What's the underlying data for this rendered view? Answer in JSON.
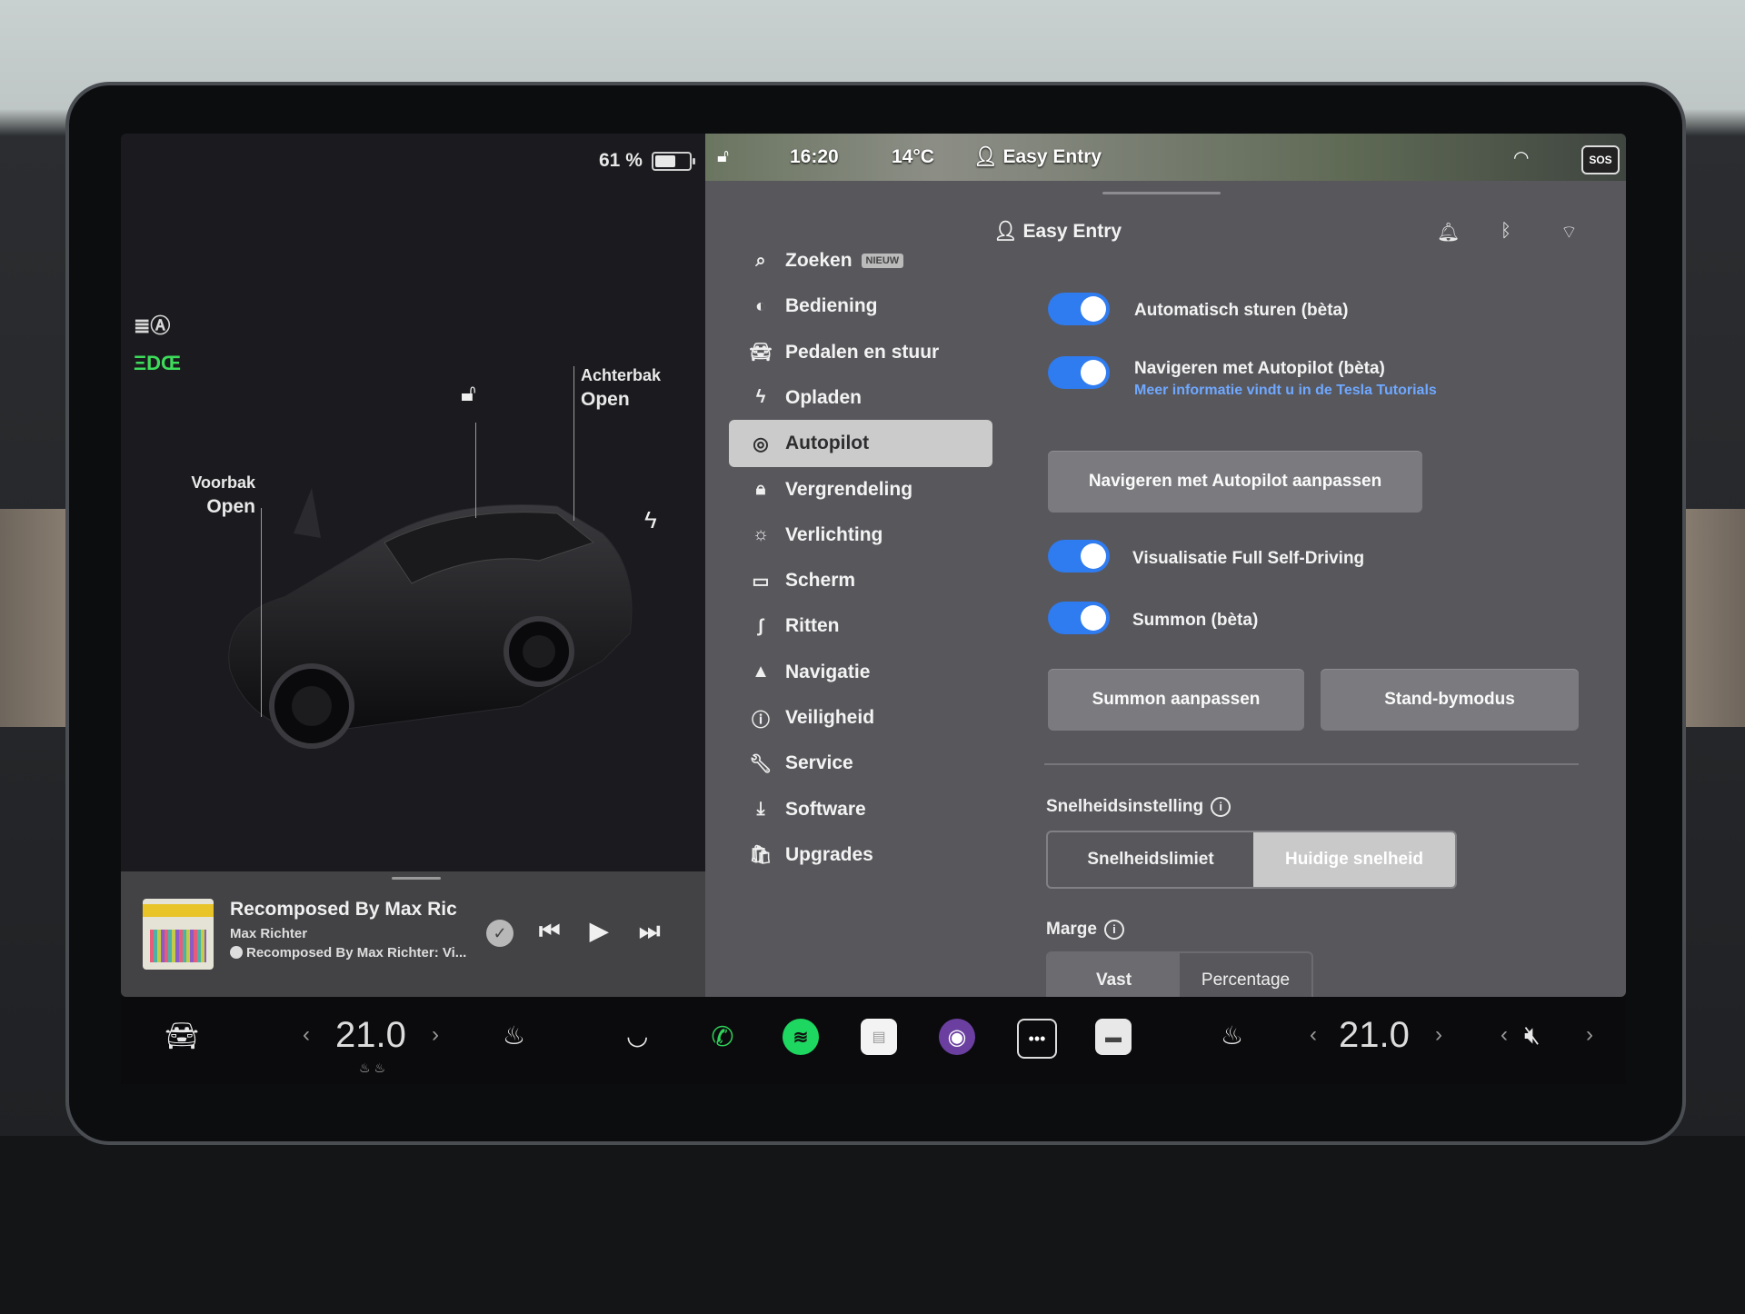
{
  "status": {
    "battery_pct": "61 %",
    "battery_level": 0.61,
    "time": "16:20",
    "outside_temp": "14°C",
    "profile": "Easy Entry",
    "sos": "SOS"
  },
  "car": {
    "frunk_label": "Voorbak",
    "frunk_state": "Open",
    "trunk_label": "Achterbak",
    "trunk_state": "Open"
  },
  "media": {
    "title": "Recomposed By Max Richter",
    "artist": "Max Richter",
    "album": "Recomposed By Max Richter: Vi..."
  },
  "nav": [
    {
      "label": "Zoeken",
      "badge": "NIEUW",
      "icon": "search-icon"
    },
    {
      "label": "Bediening",
      "icon": "toggle-icon"
    },
    {
      "label": "Pedalen en stuur",
      "icon": "car-icon"
    },
    {
      "label": "Opladen",
      "icon": "bolt-icon"
    },
    {
      "label": "Autopilot",
      "icon": "steering-wheel-icon",
      "active": true
    },
    {
      "label": "Vergrendeling",
      "icon": "lock-icon"
    },
    {
      "label": "Verlichting",
      "icon": "sun-icon"
    },
    {
      "label": "Scherm",
      "icon": "display-icon"
    },
    {
      "label": "Ritten",
      "icon": "trips-icon"
    },
    {
      "label": "Navigatie",
      "icon": "navigation-icon"
    },
    {
      "label": "Veiligheid",
      "icon": "safety-icon"
    },
    {
      "label": "Service",
      "icon": "wrench-icon"
    },
    {
      "label": "Software",
      "icon": "download-icon"
    },
    {
      "label": "Upgrades",
      "icon": "bag-icon"
    }
  ],
  "autopilot": {
    "profile": "Easy Entry",
    "autosteer": "Automatisch sturen (bèta)",
    "nav_on_autopilot": "Navigeren met Autopilot (bèta)",
    "tutorial_link": "Meer informatie vindt u in de Tesla Tutorials",
    "customize_nav_btn": "Navigeren met Autopilot aanpassen",
    "fsd_visual": "Visualisatie Full Self-Driving",
    "summon": "Summon (bèta)",
    "summon_btn": "Summon aanpassen",
    "standby_btn": "Stand-bymodus",
    "speed_setting": "Snelheidsinstelling",
    "speed_limit": "Snelheidslimiet",
    "current_speed": "Huidige snelheid",
    "margin": "Marge",
    "fixed": "Vast",
    "percentage": "Percentage"
  },
  "dock": {
    "temp_left": "21.0",
    "temp_right": "21.0"
  },
  "colors": {
    "toggle_on": "#2f7bf0",
    "link": "#6fa8ff",
    "headlight_green": "#3ddc5a",
    "phone_green": "#2fd35a",
    "spotify_green": "#1ed760"
  }
}
